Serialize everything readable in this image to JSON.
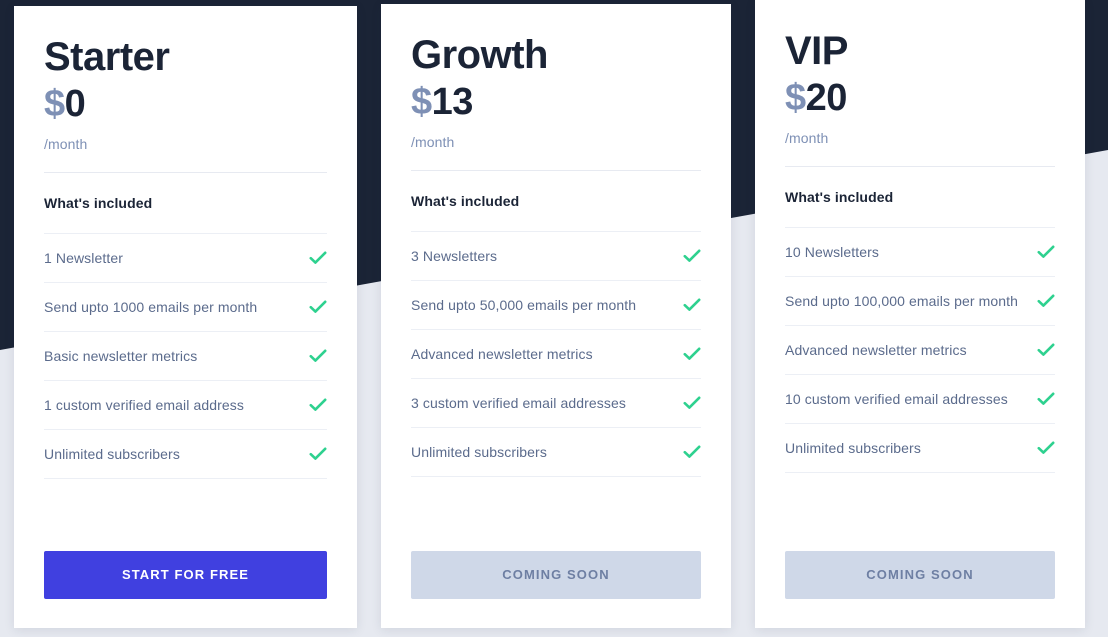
{
  "theme": {
    "page_background": "#e6e9f0",
    "band_color": "#1b2436",
    "card_background": "#ffffff",
    "heading_color": "#1b2436",
    "currency_color": "#7e90b5",
    "muted_text_color": "#5b6b8c",
    "check_color": "#2ed18f",
    "primary_button_color": "#4040e0",
    "disabled_button_color": "#cfd8e8",
    "disabled_button_text_color": "#6e7fa3"
  },
  "plans": [
    {
      "name": "Starter",
      "currency": "$",
      "amount": "0",
      "period": "/month",
      "included_label": "What's included",
      "features": [
        "1 Newsletter",
        "Send upto 1000 emails per month",
        "Basic newsletter metrics",
        "1 custom verified email address",
        "Unlimited subscribers"
      ],
      "cta_label": "START FOR FREE",
      "cta_state": "primary"
    },
    {
      "name": "Growth",
      "currency": "$",
      "amount": "13",
      "period": "/month",
      "included_label": "What's included",
      "features": [
        "3 Newsletters",
        "Send upto 50,000 emails per month",
        "Advanced newsletter metrics",
        "3 custom verified email addresses",
        "Unlimited subscribers"
      ],
      "cta_label": "COMING SOON",
      "cta_state": "disabled"
    },
    {
      "name": "VIP",
      "currency": "$",
      "amount": "20",
      "period": "/month",
      "included_label": "What's included",
      "features": [
        "10 Newsletters",
        "Send upto 100,000 emails per month",
        "Advanced newsletter metrics",
        "10 custom verified email addresses",
        "Unlimited subscribers"
      ],
      "cta_label": "COMING SOON",
      "cta_state": "disabled"
    }
  ]
}
